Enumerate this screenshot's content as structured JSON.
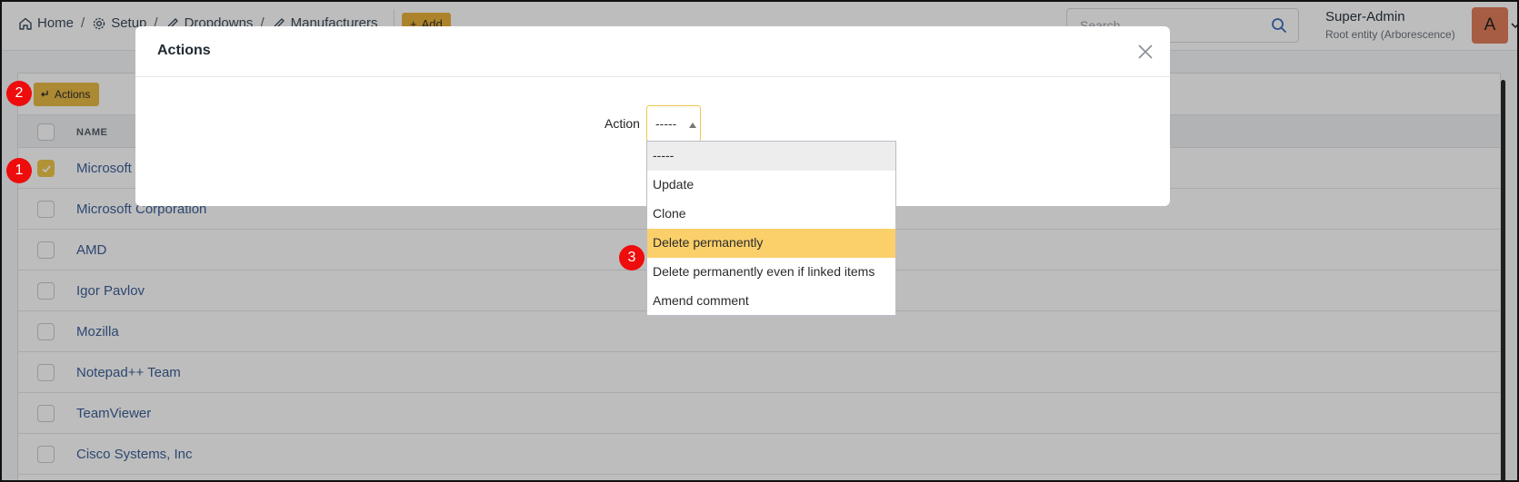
{
  "header": {
    "breadcrumb": [
      {
        "label": "Home",
        "icon": "home-icon"
      },
      {
        "label": "Setup",
        "icon": "gear-icon"
      },
      {
        "label": "Dropdowns",
        "icon": "edit-icon"
      },
      {
        "label": "Manufacturers",
        "icon": "edit-icon"
      }
    ],
    "separator": "/",
    "add_label": "Add",
    "search_placeholder": "Search",
    "user_name": "Super-Admin",
    "user_entity": "Root entity (Arborescence)",
    "avatar_letter": "A"
  },
  "table": {
    "actions_label": "Actions",
    "column_name": "NAME",
    "rows": [
      {
        "name": "Microsoft",
        "checked": true
      },
      {
        "name": "Microsoft Corporation",
        "checked": false
      },
      {
        "name": "AMD",
        "checked": false
      },
      {
        "name": "Igor Pavlov",
        "checked": false
      },
      {
        "name": "Mozilla",
        "checked": false
      },
      {
        "name": "Notepad++ Team",
        "checked": false
      },
      {
        "name": "TeamViewer",
        "checked": false
      },
      {
        "name": "Cisco Systems, Inc",
        "checked": false
      }
    ]
  },
  "modal": {
    "title": "Actions",
    "field_label": "Action",
    "selected_value": "-----",
    "options": [
      "-----",
      "Update",
      "Clone",
      "Delete permanently",
      "Delete permanently even if linked items",
      "Amend comment"
    ],
    "highlighted_option": "Delete permanently"
  },
  "markers": [
    "1",
    "2",
    "3"
  ],
  "colors": {
    "accent": "#e8b946",
    "highlight": "#fbd06a",
    "link": "#3d6098",
    "marker": "#ee0c0c"
  }
}
